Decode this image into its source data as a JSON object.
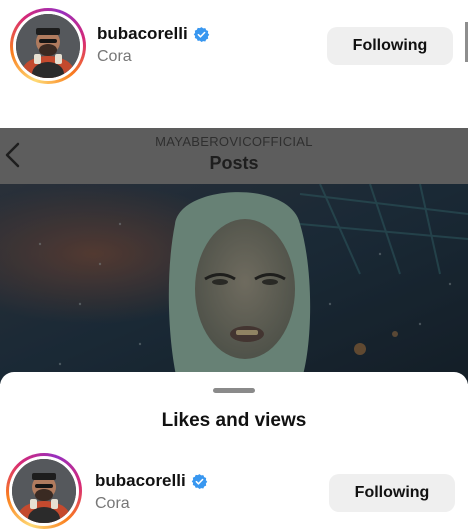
{
  "profile": {
    "username": "bubacorelli",
    "subtitle": "Cora",
    "follow_label": "Following"
  },
  "posts_header": {
    "account": "MAYABEROVICOFFICIAL",
    "title": "Posts"
  },
  "sheet": {
    "title": "Likes and views",
    "row": {
      "username": "bubacorelli",
      "subtitle": "Cora",
      "follow_label": "Following"
    }
  },
  "colors": {
    "verified": "#3897f0",
    "button_bg": "#efefef",
    "dim_header": "#5d5d5d"
  }
}
